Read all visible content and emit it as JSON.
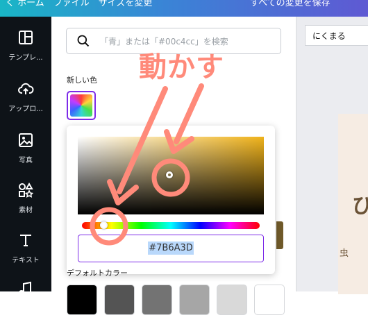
{
  "topbar": {
    "left_text": "く ホーム　ファイル　サイズを変更",
    "right_text": "すべての変更を保存"
  },
  "sidebar": {
    "items": [
      {
        "label": "テンプレ...",
        "icon": "template-icon"
      },
      {
        "label": "アップロ...",
        "icon": "upload-cloud-icon"
      },
      {
        "label": "写真",
        "icon": "photo-icon"
      },
      {
        "label": "素材",
        "icon": "elements-icon"
      },
      {
        "label": "テキスト",
        "icon": "text-icon"
      },
      {
        "label": "",
        "icon": "music-icon"
      }
    ]
  },
  "panel": {
    "search": {
      "placeholder": "「青」または「#00c4cc」を検索",
      "value": ""
    },
    "new_color_label": "新しい色",
    "preset_label": "デフォルトカラー",
    "picker": {
      "hex_value": "#7B6A3D",
      "sv_base_color": "#f0b31b",
      "hue_level": 0.12
    },
    "presets": [
      "#000000",
      "#545454",
      "#737373",
      "#a6a6a6",
      "#d9d9d9",
      "#ffffff"
    ]
  },
  "right": {
    "font_select": "にくまる",
    "canvas_glyph": "ひ",
    "canvas_small": "虫"
  },
  "annotation": {
    "text": "動かす",
    "color": "#ff8a7a"
  },
  "colors": {
    "accent": "#7d2ae8",
    "sidebar_bg": "#0e1318"
  }
}
